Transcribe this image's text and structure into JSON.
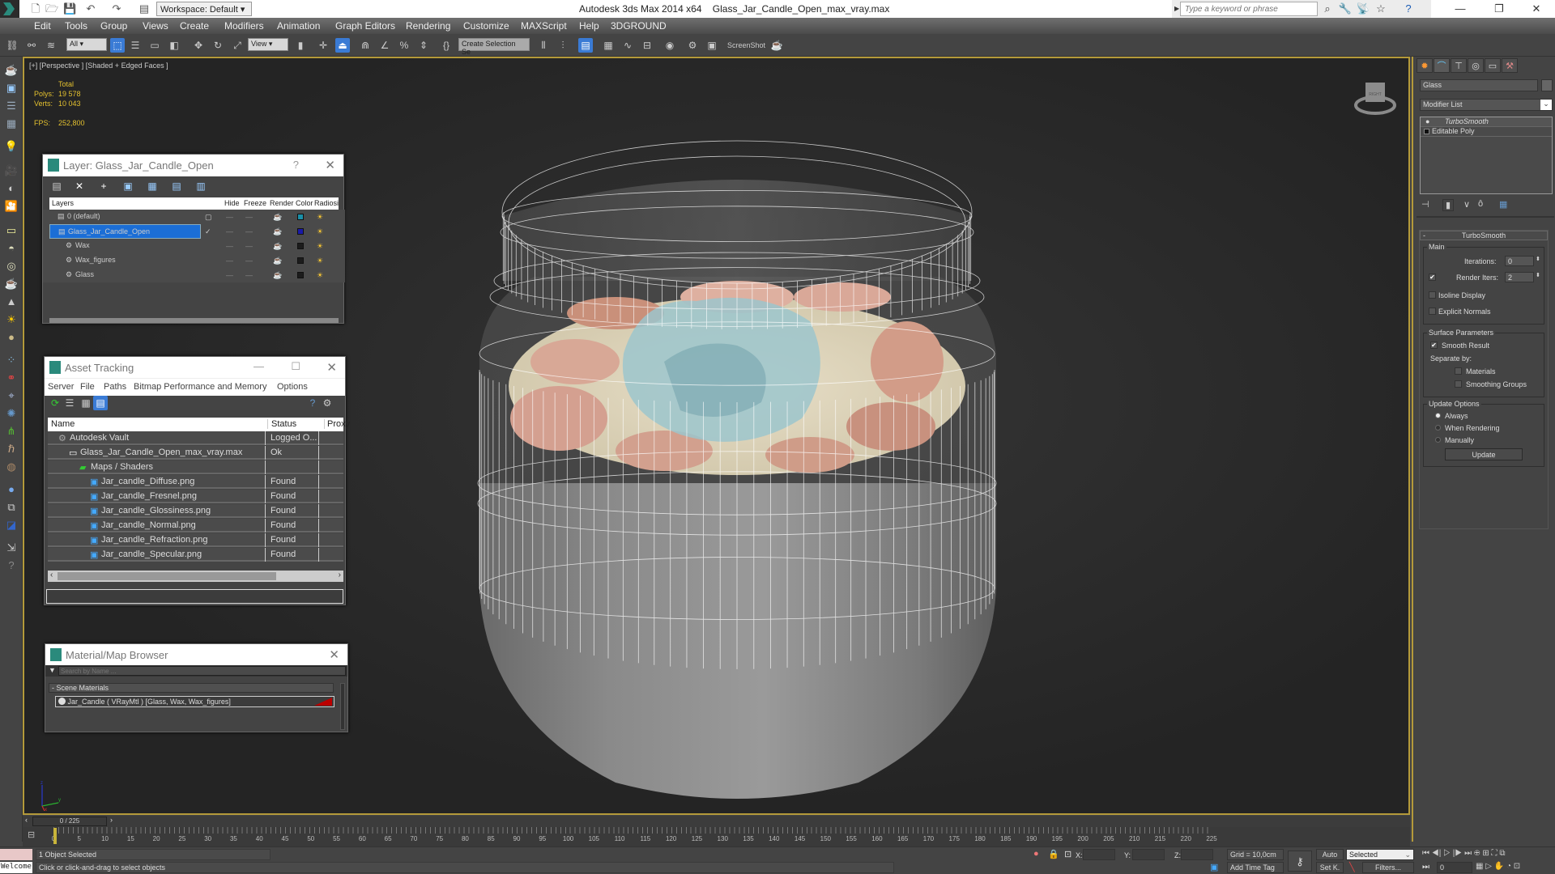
{
  "titlebar": {
    "app_title": "Autodesk 3ds Max  2014 x64",
    "file_title": "Glass_Jar_Candle_Open_max_vray.max",
    "workspace": "Workspace: Default",
    "search_placeholder": "Type a keyword or phrase"
  },
  "menu": [
    "Edit",
    "Tools",
    "Group",
    "Views",
    "Create",
    "Modifiers",
    "Animation",
    "Graph Editors",
    "Rendering",
    "Customize",
    "MAXScript",
    "Help",
    "3DGROUND"
  ],
  "toolbar": {
    "selection_filter": "All",
    "ref_coord": "View",
    "named_selection": "Create Selection Se",
    "screenshot_label": "ScreenShot"
  },
  "viewport": {
    "label": "[+] [Perspective ] [Shaded + Edged Faces ]",
    "stats": {
      "header": "Total",
      "polys_label": "Polys:",
      "polys": "19 578",
      "verts_label": "Verts:",
      "verts": "10 043",
      "fps_label": "FPS:",
      "fps": "252,800"
    },
    "viewcube_label": "RIGHT",
    "axis": {
      "x": "x",
      "y": "y",
      "z": "z"
    }
  },
  "layer_window": {
    "title": "Layer: Glass_Jar_Candle_Open",
    "help": "?",
    "columns": [
      "Layers",
      "",
      "Hide",
      "Freeze",
      "Render",
      "Color",
      "Radiosit"
    ],
    "rows": [
      {
        "name": "0 (default)",
        "indent": 0,
        "selected": false,
        "color": "#1a8fa8",
        "current": "box"
      },
      {
        "name": "Glass_Jar_Candle_Open",
        "indent": 0,
        "selected": true,
        "color": "#1a1aa8",
        "current": "check"
      },
      {
        "name": "Wax",
        "indent": 1,
        "selected": false,
        "color": "#1c1c1c",
        "current": ""
      },
      {
        "name": "Wax_figures",
        "indent": 1,
        "selected": false,
        "color": "#1c1c1c",
        "current": ""
      },
      {
        "name": "Glass",
        "indent": 1,
        "selected": false,
        "color": "#1c1c1c",
        "current": ""
      }
    ]
  },
  "asset_tracking": {
    "title": "Asset Tracking",
    "menu": [
      "Server",
      "File",
      "Paths",
      "Bitmap Performance and Memory",
      "Options"
    ],
    "columns": [
      "Name",
      "Status",
      "Proxy"
    ],
    "rows": [
      {
        "name": "Autodesk Vault",
        "status": "Logged O...",
        "indent": 1,
        "icon": "vault-icon"
      },
      {
        "name": "Glass_Jar_Candle_Open_max_vray.max",
        "status": "Ok",
        "indent": 2,
        "icon": "max-file-icon"
      },
      {
        "name": "Maps / Shaders",
        "status": "",
        "indent": 3,
        "icon": "maps-folder-icon"
      },
      {
        "name": "Jar_candle_Diffuse.png",
        "status": "Found",
        "indent": 4,
        "icon": "image-file-icon"
      },
      {
        "name": "Jar_candle_Fresnel.png",
        "status": "Found",
        "indent": 4,
        "icon": "image-file-icon"
      },
      {
        "name": "Jar_candle_Glossiness.png",
        "status": "Found",
        "indent": 4,
        "icon": "image-file-icon"
      },
      {
        "name": "Jar_candle_Normal.png",
        "status": "Found",
        "indent": 4,
        "icon": "image-file-icon"
      },
      {
        "name": "Jar_candle_Refraction.png",
        "status": "Found",
        "indent": 4,
        "icon": "image-file-icon"
      },
      {
        "name": "Jar_candle_Specular.png",
        "status": "Found",
        "indent": 4,
        "icon": "image-file-icon"
      }
    ]
  },
  "material_browser": {
    "title": "Material/Map Browser",
    "search_placeholder": "Search by Name ...",
    "group": "- Scene Materials",
    "item": "Jar_Candle  ( VRayMtl ) [Glass, Wax, Wax_figures]"
  },
  "command_panel": {
    "object_name": "Glass",
    "modifier_list": "Modifier List",
    "stack": [
      "TurboSmooth",
      "Editable Poly"
    ],
    "rollout_title": "TurboSmooth",
    "main": {
      "label": "Main",
      "iterations_label": "Iterations:",
      "iterations": "0",
      "render_iters_label": "Render Iters:",
      "render_iters": "2",
      "render_iters_checked": true,
      "isoline_label": "Isoline Display",
      "isoline": false,
      "explicit_label": "Explicit Normals",
      "explicit": false
    },
    "surface": {
      "label": "Surface Parameters",
      "smooth_result_label": "Smooth Result",
      "smooth_result": true,
      "separate_by": "Separate by:",
      "materials_label": "Materials",
      "materials": false,
      "smoothing_label": "Smoothing Groups",
      "smoothing": false
    },
    "update": {
      "label": "Update Options",
      "options": [
        "Always",
        "When Rendering",
        "Manually"
      ],
      "selected": "Always",
      "button": "Update"
    }
  },
  "timeline": {
    "frame_display": "0 / 225",
    "ticks": [
      0,
      5,
      10,
      15,
      20,
      25,
      30,
      35,
      40,
      45,
      50,
      55,
      60,
      65,
      70,
      75,
      80,
      85,
      90,
      95,
      100,
      105,
      110,
      115,
      120,
      125,
      130,
      135,
      140,
      145,
      150,
      155,
      160,
      165,
      170,
      175,
      180,
      185,
      190,
      195,
      200,
      205,
      210,
      215,
      220,
      225
    ],
    "current_frame": 0,
    "max_frame": 225
  },
  "status": {
    "maxscript": "Welcome tc",
    "selection": "1 Object Selected",
    "prompt": "Click or click-and-drag to select objects",
    "x_label": "X:",
    "y_label": "Y:",
    "z_label": "Z:",
    "grid": "Grid = 10,0cm",
    "add_time_tag": "Add Time Tag",
    "auto": "Auto",
    "setk": "Set K.",
    "key_filter": "Selected",
    "filters": "Filters...",
    "frame": "0"
  }
}
